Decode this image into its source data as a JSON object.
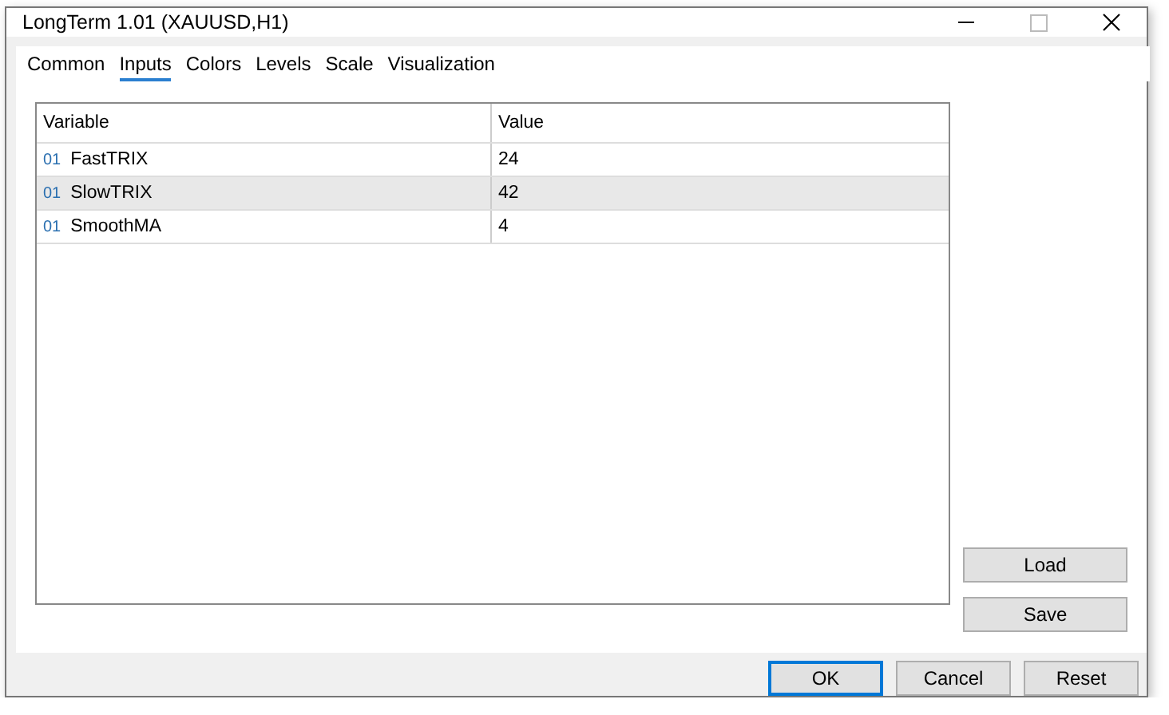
{
  "window": {
    "title": "LongTerm 1.01 (XAUUSD,H1)"
  },
  "tabs": [
    {
      "label": "Common",
      "selected": false
    },
    {
      "label": "Inputs",
      "selected": true
    },
    {
      "label": "Colors",
      "selected": false
    },
    {
      "label": "Levels",
      "selected": false
    },
    {
      "label": "Scale",
      "selected": false
    },
    {
      "label": "Visualization",
      "selected": false
    }
  ],
  "table": {
    "columns": [
      "Variable",
      "Value"
    ],
    "rows": [
      {
        "type_badge": "01",
        "variable": "FastTRIX",
        "value": "24",
        "selected": false
      },
      {
        "type_badge": "01",
        "variable": "SlowTRIX",
        "value": "42",
        "selected": true
      },
      {
        "type_badge": "01",
        "variable": "SmoothMA",
        "value": "4",
        "selected": false
      }
    ]
  },
  "side_buttons": [
    "Load",
    "Save"
  ],
  "buttons": [
    {
      "label": "OK",
      "default": true
    },
    {
      "label": "Cancel",
      "default": false
    },
    {
      "label": "Reset",
      "default": false
    }
  ]
}
